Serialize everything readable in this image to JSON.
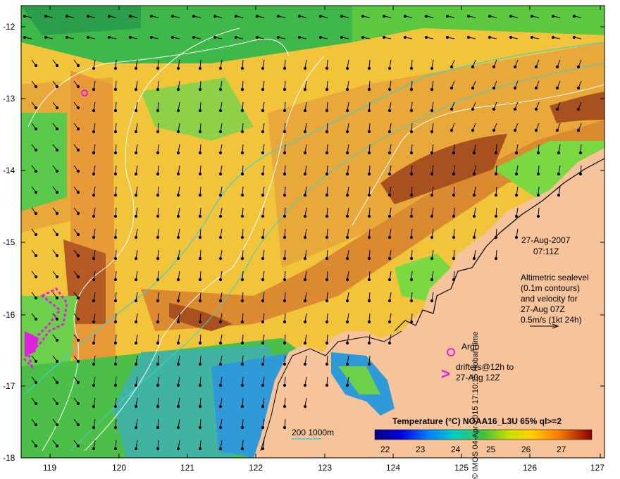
{
  "map": {
    "date": "27-Aug-2007",
    "time": "07:11Z",
    "info_lines": [
      "Altimetric sealevel",
      "(0.1m contours)",
      "and velocity for",
      "27-Aug 07Z",
      "0.5m/s (1kt 24h)"
    ],
    "legend_argo": "Argo",
    "legend_drifters_1": "drifters@12h to",
    "legend_drifters_2": "27-Aug 12Z",
    "bathy_label": "200  1000m",
    "colorbar_title": "Temperature (°C) NOAA16_L3U 65% ql>=2",
    "colorbar_ticks": [
      "22",
      "23",
      "24",
      "25",
      "26",
      "27"
    ],
    "credit": "© IMOS 04-Apr-2015 17:10:15 Hobart time",
    "lat_ticks": [
      "-12",
      "-13",
      "-14",
      "-15",
      "-16",
      "-17",
      "-18"
    ],
    "lon_ticks": [
      "119",
      "120",
      "121",
      "122",
      "123",
      "124",
      "125",
      "126",
      "127"
    ]
  },
  "colors": {
    "land": "#f7c39a",
    "sst_warm": "#e8a83a",
    "sst_hot": "#a8501e",
    "sst_mid": "#f2d23c",
    "sst_cool": "#6fcf3b",
    "sst_cold": "#1f7fd8",
    "argo": "#e020e0",
    "bathy": "#3fd0d0"
  }
}
